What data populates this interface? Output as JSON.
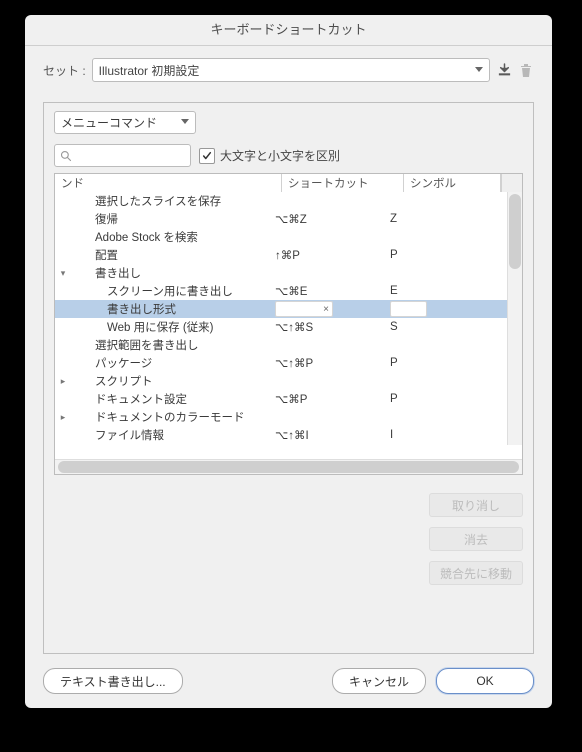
{
  "window_title": "キーボードショートカット",
  "set_label": "セット :",
  "set_value": "Illustrator 初期設定",
  "category_value": "メニューコマンド",
  "case_sensitive_label": "大文字と小文字を区別",
  "case_sensitive_checked": true,
  "columns": {
    "c1": "ンド",
    "c2": "ショートカット",
    "c3": "シンボル"
  },
  "rows": [
    {
      "indent": 2,
      "disclosure": "",
      "label": "選択したスライスを保存",
      "shortcut": "",
      "symbol": ""
    },
    {
      "indent": 2,
      "disclosure": "",
      "label": "復帰",
      "shortcut": "⌥⌘Z",
      "symbol": "Z"
    },
    {
      "indent": 2,
      "disclosure": "",
      "label": "Adobe Stock を検索",
      "shortcut": "",
      "symbol": ""
    },
    {
      "indent": 2,
      "disclosure": "",
      "label": "配置",
      "shortcut": "↑⌘P",
      "symbol": "P"
    },
    {
      "indent": 2,
      "disclosure": "v",
      "label": "書き出し",
      "shortcut": "",
      "symbol": ""
    },
    {
      "indent": 3,
      "disclosure": "",
      "label": "スクリーン用に書き出し",
      "shortcut": "⌥⌘E",
      "symbol": "E"
    },
    {
      "indent": 3,
      "disclosure": "",
      "label": "書き出し形式",
      "shortcut": "×",
      "symbol": "",
      "selected": true
    },
    {
      "indent": 3,
      "disclosure": "",
      "label": "Web 用に保存 (従来)",
      "shortcut": "⌥↑⌘S",
      "symbol": "S"
    },
    {
      "indent": 2,
      "disclosure": "",
      "label": "選択範囲を書き出し",
      "shortcut": "",
      "symbol": ""
    },
    {
      "indent": 2,
      "disclosure": "",
      "label": "パッケージ",
      "shortcut": "⌥↑⌘P",
      "symbol": "P"
    },
    {
      "indent": 2,
      "disclosure": ">",
      "label": "スクリプト",
      "shortcut": "",
      "symbol": ""
    },
    {
      "indent": 2,
      "disclosure": "",
      "label": "ドキュメント設定",
      "shortcut": "⌥⌘P",
      "symbol": "P"
    },
    {
      "indent": 2,
      "disclosure": ">",
      "label": "ドキュメントのカラーモード",
      "shortcut": "",
      "symbol": ""
    },
    {
      "indent": 2,
      "disclosure": "",
      "label": "ファイル情報",
      "shortcut": "⌥↑⌘I",
      "symbol": "I"
    }
  ],
  "buttons": {
    "undo": "取り消し",
    "clear": "消去",
    "go_conflict": "競合先に移動",
    "export_text": "テキスト書き出し...",
    "cancel": "キャンセル",
    "ok": "OK"
  }
}
